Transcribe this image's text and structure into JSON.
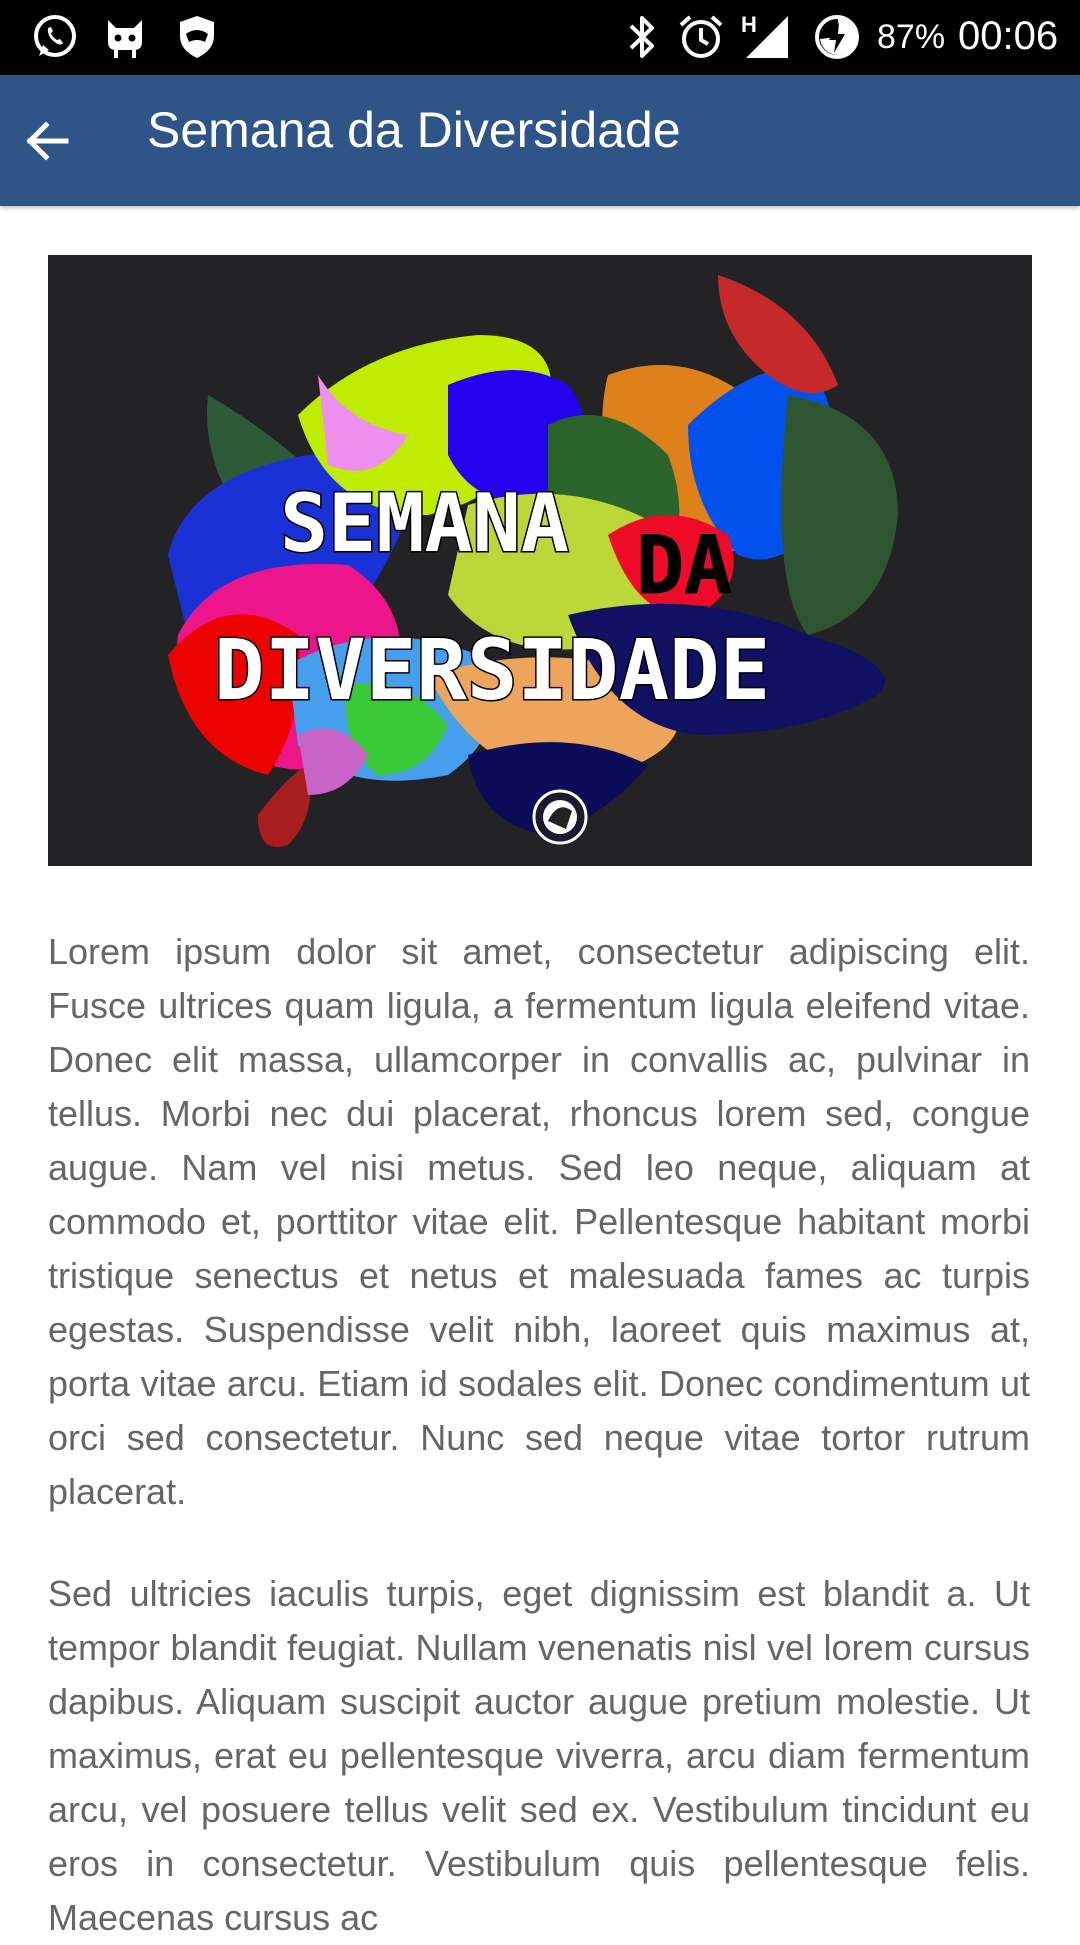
{
  "status_bar": {
    "battery": "87%",
    "time": "00:06",
    "network_label": "H",
    "icons": [
      "whatsapp-icon",
      "cyanogen-icon",
      "shield-icon",
      "bluetooth-icon",
      "alarm-icon",
      "signal-icon",
      "battery-charging-icon"
    ]
  },
  "app_bar": {
    "title": "Semana da Diversidade",
    "back_icon": "arrow-back-icon",
    "color": "#2f5487"
  },
  "banner": {
    "line1": "SEMANA",
    "line2": "DA",
    "line3": "DIVERSIDADE",
    "background": "#232325"
  },
  "article": {
    "paragraphs": [
      "Lorem ipsum dolor sit amet, consectetur adipiscing elit. Fusce ultrices quam ligula, a fermentum ligula eleifend vitae. Donec elit massa, ullamcorper in convallis ac, pulvinar in tellus. Morbi nec dui placerat, rhoncus lorem sed, congue augue. Nam vel nisi metus. Sed leo neque, aliquam at commodo et, porttitor vitae elit. Pellentesque habitant morbi tristique senectus et netus et malesuada fames ac turpis egestas. Suspendisse velit nibh, laoreet quis maximus at, porta vitae arcu. Etiam id sodales elit. Donec condimentum ut orci sed consectetur. Nunc sed neque vitae tortor rutrum placerat.",
      "Sed ultricies iaculis turpis, eget dignissim est blandit a. Ut tempor blandit feugiat. Nullam venenatis nisl vel lorem cursus dapibus. Aliquam suscipit auctor augue pretium molestie. Ut maximus, erat eu pellentesque viverra, arcu diam fermentum arcu, vel posuere tellus velit sed ex. Vestibulum tincidunt eu eros in consectetur. Vestibulum quis pellentesque felis. Maecenas cursus ac"
    ]
  }
}
